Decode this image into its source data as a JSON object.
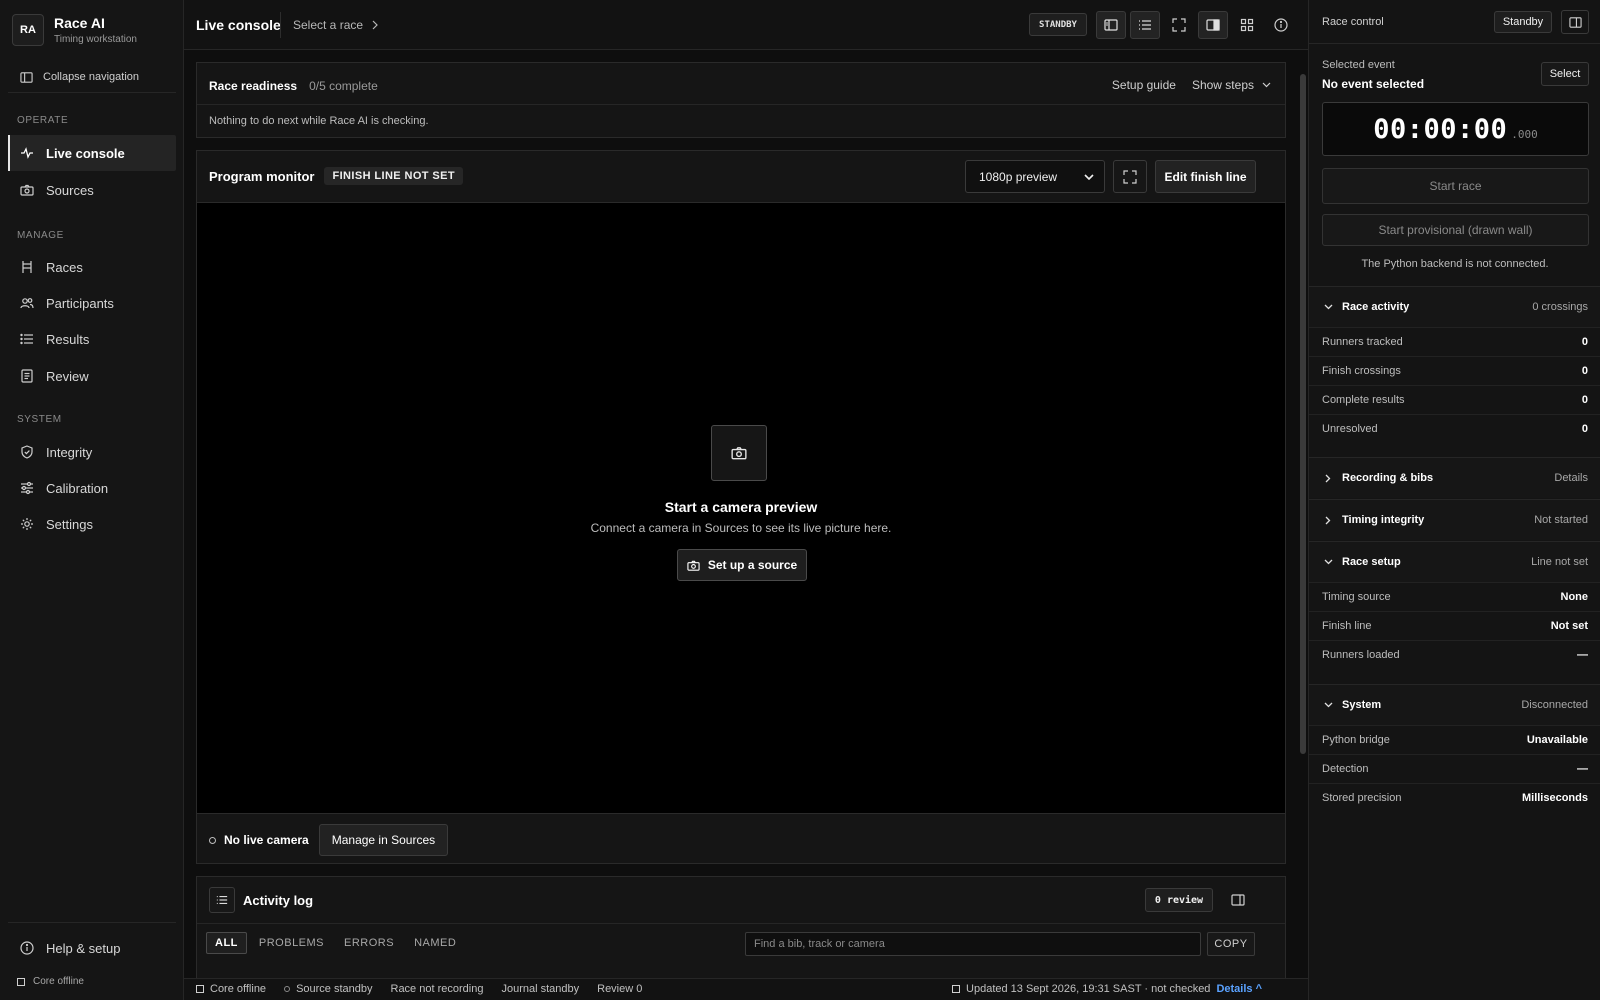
{
  "brand": {
    "badge": "RA",
    "title": "Race AI",
    "subtitle": "Timing workstation"
  },
  "sidebar": {
    "collapse_label": "Collapse navigation",
    "sections": {
      "operate": "OPERATE",
      "manage": "MANAGE",
      "system": "SYSTEM"
    },
    "items": {
      "live_console": "Live console",
      "sources": "Sources",
      "races": "Races",
      "participants": "Participants",
      "results": "Results",
      "review": "Review",
      "integrity": "Integrity",
      "calibration": "Calibration",
      "settings": "Settings",
      "help": "Help & setup"
    },
    "core_status": "Core offline"
  },
  "topbar": {
    "title": "Live console",
    "select_race": "Select a race",
    "standby": "STANDBY"
  },
  "readiness": {
    "title": "Race readiness",
    "count": "0/5 complete",
    "setup_guide": "Setup guide",
    "show_steps": "Show steps",
    "message": "Nothing to do next while Race AI is checking."
  },
  "monitor": {
    "title": "Program monitor",
    "badge": "FINISH LINE NOT SET",
    "preview_option": "1080p preview",
    "edit_finish": "Edit finish line",
    "empty_title": "Start a camera preview",
    "empty_sub": "Connect a camera in Sources to see its live picture here.",
    "setup_source": "Set up a source",
    "no_live": "No live camera",
    "manage_sources": "Manage in Sources"
  },
  "activity": {
    "title": "Activity log",
    "review_badge": "0 review",
    "filters": {
      "all": "ALL",
      "problems": "PROBLEMS",
      "errors": "ERRORS",
      "named": "NAMED"
    },
    "search_placeholder": "Find a bib, track or camera",
    "copy": "COPY"
  },
  "statusbar": {
    "core": "Core offline",
    "source": "Source standby",
    "race": "Race not recording",
    "journal": "Journal standby",
    "review": "Review 0",
    "updated": "Updated 13 Sept 2026, 19:31 SAST · not checked",
    "details": "Details ^"
  },
  "race_control": {
    "title": "Race control",
    "standby": "Standby",
    "selected_label": "Selected event",
    "selected_value": "No event selected",
    "select_btn": "Select",
    "clock_main": "00:00:00",
    "clock_ms": ".000",
    "start_race": "Start race",
    "start_provisional": "Start provisional (drawn wall)",
    "backend_msg": "The Python backend is not connected.",
    "activity": {
      "name": "Race activity",
      "meta": "0 crossings",
      "rows": [
        {
          "k": "Runners tracked",
          "v": "0"
        },
        {
          "k": "Finish crossings",
          "v": "0"
        },
        {
          "k": "Complete results",
          "v": "0"
        },
        {
          "k": "Unresolved",
          "v": "0"
        }
      ]
    },
    "recording": {
      "name": "Recording & bibs",
      "meta": "Details"
    },
    "integrity": {
      "name": "Timing integrity",
      "meta": "Not started"
    },
    "setup": {
      "name": "Race setup",
      "meta": "Line not set",
      "rows": [
        {
          "k": "Timing source",
          "v": "None"
        },
        {
          "k": "Finish line",
          "v": "Not set"
        },
        {
          "k": "Runners loaded",
          "v": "—"
        }
      ]
    },
    "system": {
      "name": "System",
      "meta": "Disconnected",
      "rows": [
        {
          "k": "Python bridge",
          "v": "Unavailable"
        },
        {
          "k": "Detection",
          "v": "—"
        },
        {
          "k": "Stored precision",
          "v": "Milliseconds"
        }
      ]
    }
  }
}
